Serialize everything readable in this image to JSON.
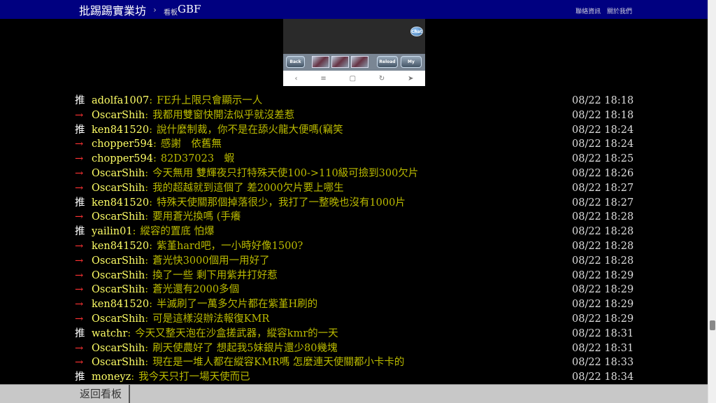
{
  "header": {
    "brand": "批踢踢實業坊",
    "separator": "›",
    "board_label": "看板",
    "board_name": "GBF",
    "links": [
      "聯絡資訊",
      "關於我們"
    ]
  },
  "embed": {
    "chat_label": "Chat",
    "back_label": "Back",
    "reload_label": "Reload",
    "mypage_label": "My Page",
    "nav_icons": [
      "‹",
      "≡",
      "▢",
      "↻",
      "➤"
    ]
  },
  "pushes": [
    {
      "tag": "推",
      "user": "adolfa1007",
      "content": "FE升上限只會顯示一人",
      "time": "08/22 18:18"
    },
    {
      "tag": "→",
      "user": "OscarShih",
      "content": "我都用雙窗快開法似乎就沒差惹",
      "time": "08/22 18:18"
    },
    {
      "tag": "推",
      "user": "ken841520",
      "content": "說什麼制裁，你不是在舔火龍大便嗎(竊笑",
      "time": "08/22 18:24"
    },
    {
      "tag": "→",
      "user": "chopper594",
      "content": "感謝　依舊無",
      "time": "08/22 18:24"
    },
    {
      "tag": "→",
      "user": "chopper594",
      "content": "82D37023　蝦",
      "time": "08/22 18:25"
    },
    {
      "tag": "→",
      "user": "OscarShih",
      "content": "今天無用 雙輝夜只打特殊天使100->110級可撿到300欠片",
      "time": "08/22 18:26"
    },
    {
      "tag": "→",
      "user": "OscarShih",
      "content": "我的超越就到這個了 差2000欠片要上哪生",
      "time": "08/22 18:27"
    },
    {
      "tag": "推",
      "user": "ken841520",
      "content": "特殊天使關那個掉落很少，我打了一整晚也沒有1000片",
      "time": "08/22 18:27"
    },
    {
      "tag": "→",
      "user": "OscarShih",
      "content": "要用蒼光換嗎 (手癢",
      "time": "08/22 18:28"
    },
    {
      "tag": "推",
      "user": "yailin01",
      "content": "縱容的置底 怕爆",
      "time": "08/22 18:28"
    },
    {
      "tag": "→",
      "user": "ken841520",
      "content": "紫堇hard吧，一小時好像1500?",
      "time": "08/22 18:28"
    },
    {
      "tag": "→",
      "user": "OscarShih",
      "content": "蒼光快3000個用一用好了",
      "time": "08/22 18:28"
    },
    {
      "tag": "→",
      "user": "OscarShih",
      "content": "換了一些 剩下用紫井打好惹",
      "time": "08/22 18:29"
    },
    {
      "tag": "→",
      "user": "OscarShih",
      "content": "蒼光還有2000多個",
      "time": "08/22 18:29"
    },
    {
      "tag": "→",
      "user": "ken841520",
      "content": "半滅刷了一萬多欠片都在紫堇H刷的",
      "time": "08/22 18:29"
    },
    {
      "tag": "→",
      "user": "OscarShih",
      "content": "可是這樣沒辦法報復KMR",
      "time": "08/22 18:29"
    },
    {
      "tag": "推",
      "user": "watchr",
      "content": "今天又整天泡在沙盒搓武器，縱容kmr的一天",
      "time": "08/22 18:31"
    },
    {
      "tag": "→",
      "user": "OscarShih",
      "content": "刷天使農好了 想起我5妹銀片還少80幾塊",
      "time": "08/22 18:31"
    },
    {
      "tag": "→",
      "user": "OscarShih",
      "content": "現在是一堆人都在縱容KMR嗎 怎麼連天使關都小卡卡的",
      "time": "08/22 18:33"
    },
    {
      "tag": "推",
      "user": "moneyz",
      "content": "我今天只打一場天使而已",
      "time": "08/22 18:34"
    }
  ],
  "footer": {
    "back_to_board": "返回看板"
  }
}
